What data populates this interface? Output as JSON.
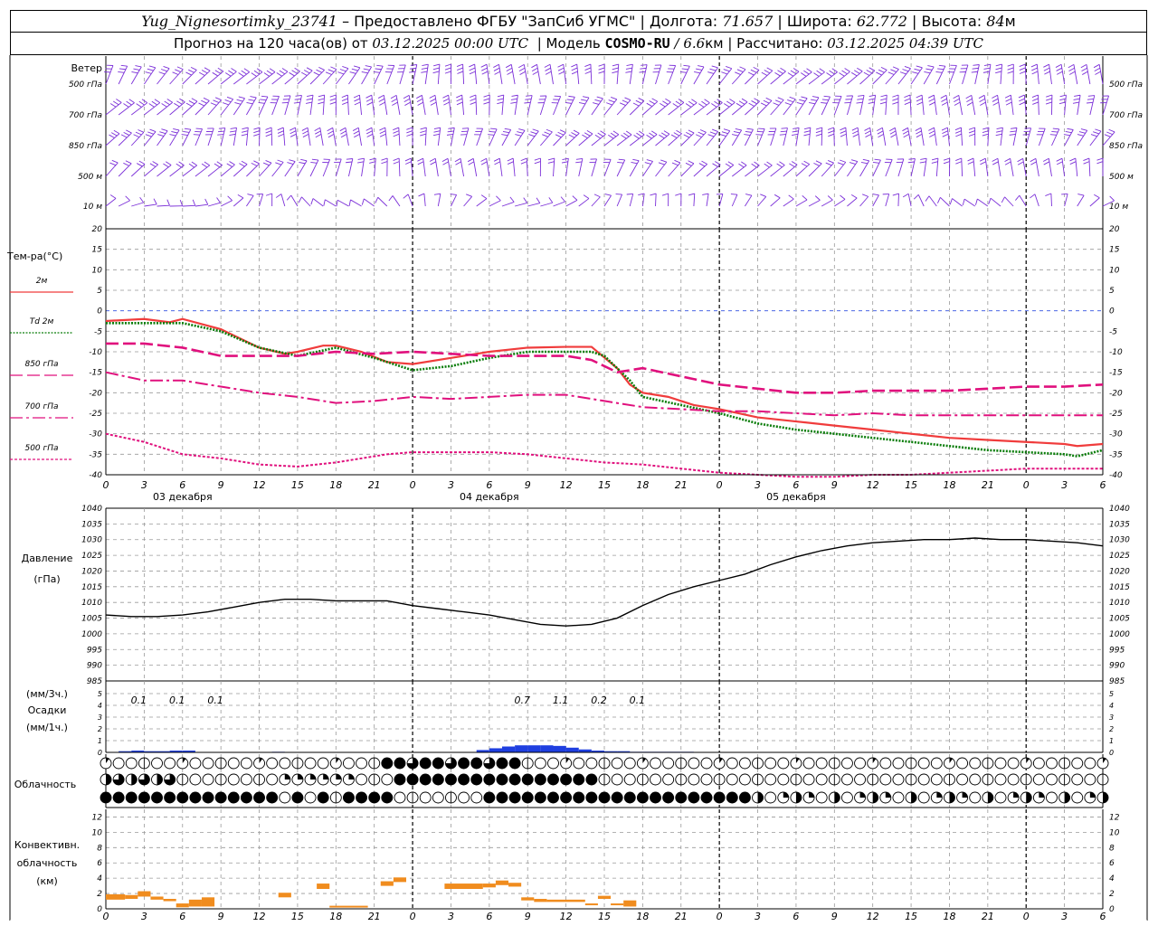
{
  "header": {
    "station": "Yug_Nignesortimky_23741",
    "dash": "–",
    "provided": "Предоставлено ФГБУ \"ЗапСиб УГМС\"",
    "lon_label": "Долгота:",
    "lon": "71.657",
    "lat_label": "Широта:",
    "lat": "62.772",
    "alt_label": "Высота:",
    "alt": "84",
    "alt_unit": "м",
    "forecast_label": "Прогноз на 120 часа(ов) от",
    "forecast_from": "03.12.2025 00:00 UTC",
    "model_label": "Модель",
    "model": "COSMO-RU",
    "resolution": "/ 6.6",
    "res_unit": "км",
    "computed_label": "Рассчитано:",
    "computed": "03.12.2025 04:39 UTC"
  },
  "wind_panel": {
    "title": "Ветер",
    "levels": [
      "500 гПа",
      "700 гПа",
      "850 гПа",
      "500 м",
      "10 м"
    ],
    "color": "#7b2fd8"
  },
  "temp_panel": {
    "title": "Тем-ра(°C)",
    "legend": [
      {
        "label": "2м",
        "color": "#f03c3c",
        "style": "solid"
      },
      {
        "label": "Td 2м",
        "color": "#0a7d0a",
        "style": "dotted"
      },
      {
        "label": "850 гПа",
        "color": "#e0107d",
        "style": "dash"
      },
      {
        "label": "700 гПа",
        "color": "#e0107d",
        "style": "dashdot"
      },
      {
        "label": "500 гПа",
        "color": "#e0107d",
        "style": "dot"
      }
    ],
    "yticks": [
      20,
      15,
      10,
      5,
      0,
      -5,
      -10,
      -15,
      -20,
      -25,
      -30,
      -35,
      -40
    ]
  },
  "time_axis": {
    "hour_labels": [
      "0",
      "3",
      "6",
      "9",
      "12",
      "15",
      "18",
      "21",
      "0",
      "3",
      "6",
      "9",
      "12",
      "15",
      "18",
      "21",
      "0",
      "3",
      "6",
      "9",
      "12",
      "15",
      "18",
      "21",
      "0",
      "3",
      "6"
    ],
    "day_labels": [
      "03 декабря",
      "04 декабря",
      "05 декабря"
    ]
  },
  "pressure_panel": {
    "title": "Давление",
    "unit": "(гПа)",
    "yticks": [
      1040,
      1035,
      1030,
      1025,
      1020,
      1015,
      1010,
      1005,
      1000,
      995,
      990,
      985
    ]
  },
  "precip_panel": {
    "unit3": "(мм/3ч.)",
    "title": "Осадки",
    "unit1": "(мм/1ч.)",
    "yticks": [
      5,
      4,
      3,
      2,
      1,
      0
    ],
    "sums": [
      {
        "t": 3,
        "v": "0.1"
      },
      {
        "t": 6,
        "v": "0.1"
      },
      {
        "t": 9,
        "v": "0.1"
      },
      {
        "t": 33,
        "v": "0.7"
      },
      {
        "t": 36,
        "v": "1.1"
      },
      {
        "t": 39,
        "v": "0.2"
      },
      {
        "t": 42,
        "v": "0.1"
      }
    ],
    "color": "#1f3fe0"
  },
  "cloud_panel": {
    "title": "Облачность"
  },
  "conv_panel": {
    "title_line1": "Конвективн.",
    "title_line2": "облачность",
    "unit": "(км)",
    "yticks": [
      12,
      10,
      8,
      6,
      4,
      2,
      0
    ],
    "color": "#f08c1e"
  },
  "chart_data": [
    {
      "type": "line",
      "title": "Тем-ра(°C)",
      "x_unit": "hours from 03.12.2025 00:00 UTC",
      "ylim": [
        -40,
        20
      ],
      "series": [
        {
          "name": "2м",
          "x": [
            0,
            3,
            5,
            6,
            9,
            12,
            14,
            15,
            17,
            18,
            20,
            22,
            24,
            27,
            30,
            33,
            36,
            38,
            40,
            41,
            42,
            44,
            46,
            48,
            51,
            54,
            57,
            60,
            63,
            66,
            69,
            72,
            75,
            76,
            78
          ],
          "values": [
            -2.5,
            -2,
            -2.8,
            -2,
            -4.5,
            -9,
            -10.5,
            -10,
            -8.5,
            -8.5,
            -10,
            -12.5,
            -13,
            -11.5,
            -10,
            -9,
            -8.8,
            -8.8,
            -14,
            -18,
            -20,
            -21,
            -23,
            -24,
            -26,
            -27,
            -28,
            -29,
            -30,
            -31,
            -31.5,
            -32,
            -32.5,
            -33,
            -32.5
          ]
        },
        {
          "name": "Td 2м",
          "x": [
            0,
            3,
            6,
            9,
            12,
            15,
            18,
            21,
            24,
            27,
            30,
            33,
            36,
            38,
            39,
            40,
            41,
            42,
            45,
            48,
            51,
            54,
            57,
            60,
            63,
            66,
            69,
            72,
            75,
            76,
            78
          ],
          "values": [
            -3,
            -3,
            -3,
            -5,
            -9,
            -11,
            -9,
            -11.5,
            -14.5,
            -13.5,
            -11.5,
            -10,
            -10,
            -10,
            -11,
            -14,
            -17,
            -21,
            -23,
            -25,
            -27.5,
            -29,
            -30,
            -31,
            -32,
            -33,
            -34,
            -34.5,
            -35,
            -35.5,
            -34
          ]
        },
        {
          "name": "850 гПа",
          "x": [
            0,
            3,
            6,
            9,
            12,
            15,
            18,
            21,
            24,
            27,
            30,
            33,
            36,
            38,
            40,
            42,
            45,
            48,
            51,
            54,
            57,
            60,
            63,
            66,
            69,
            72,
            75,
            78
          ],
          "values": [
            -8,
            -8,
            -9,
            -11,
            -11,
            -11,
            -10,
            -10.5,
            -10,
            -10.5,
            -11,
            -11,
            -11,
            -12,
            -15,
            -14,
            -16,
            -18,
            -19,
            -20,
            -20,
            -19.5,
            -19.5,
            -19.5,
            -19,
            -18.5,
            -18.5,
            -18
          ]
        },
        {
          "name": "700 гПа",
          "x": [
            0,
            3,
            6,
            9,
            12,
            15,
            18,
            21,
            24,
            27,
            30,
            33,
            36,
            39,
            42,
            45,
            48,
            51,
            54,
            57,
            60,
            63,
            66,
            69,
            72,
            75,
            78
          ],
          "values": [
            -15,
            -17,
            -17,
            -18.5,
            -20,
            -21,
            -22.5,
            -22,
            -21,
            -21.5,
            -21,
            -20.5,
            -20.5,
            -22,
            -23.5,
            -24,
            -24.5,
            -24.5,
            -25,
            -25.5,
            -25,
            -25.5,
            -25.5,
            -25.5,
            -25.5,
            -25.5,
            -25.5
          ]
        },
        {
          "name": "500 гПа",
          "x": [
            0,
            3,
            6,
            9,
            12,
            15,
            18,
            21,
            22,
            24,
            27,
            30,
            33,
            36,
            39,
            42,
            45,
            48,
            51,
            54,
            57,
            60,
            63,
            66,
            69,
            72,
            75,
            78
          ],
          "values": [
            -30,
            -32,
            -35,
            -36,
            -37.5,
            -38,
            -37,
            -35.5,
            -35,
            -34.5,
            -34.5,
            -34.5,
            -35,
            -36,
            -37,
            -37.5,
            -38.5,
            -39.5,
            -40,
            -40.5,
            -40.5,
            -40,
            -40,
            -39.5,
            -39,
            -38.5,
            -38.5,
            -38.5
          ]
        }
      ]
    },
    {
      "type": "line",
      "title": "Давление",
      "ylabel": "(гПа)",
      "ylim": [
        985,
        1040
      ],
      "series": [
        {
          "x": [
            0,
            2,
            4,
            6,
            8,
            10,
            12,
            14,
            16,
            18,
            20,
            22,
            24,
            26,
            28,
            30,
            32,
            34,
            36,
            38,
            40,
            42,
            44,
            46,
            48,
            50,
            52,
            54,
            56,
            58,
            60,
            62,
            64,
            66,
            68,
            70,
            72,
            74,
            76,
            78
          ],
          "values": [
            1006,
            1005.5,
            1005.5,
            1006,
            1007,
            1008.5,
            1010,
            1011,
            1011,
            1010.5,
            1010.5,
            1010.5,
            1009,
            1008,
            1007,
            1006,
            1004.5,
            1003,
            1002.5,
            1003,
            1005,
            1009,
            1012.5,
            1015,
            1017,
            1019,
            1022,
            1024.5,
            1026.5,
            1028,
            1029,
            1029.5,
            1030,
            1030,
            1030.5,
            1030,
            1030,
            1029.5,
            1029,
            1028
          ]
        }
      ]
    },
    {
      "type": "bar",
      "title": "Осадки",
      "ylabel": "(мм/1ч.)",
      "ylim": [
        0,
        5
      ],
      "x": [
        2,
        3,
        4,
        5,
        6,
        7,
        14,
        30,
        31,
        32,
        33,
        34,
        35,
        36,
        37,
        38,
        39,
        40,
        41,
        42,
        43,
        44,
        45,
        46
      ],
      "values": [
        0.1,
        0.15,
        0.1,
        0.1,
        0.15,
        0.15,
        0.05,
        0.2,
        0.35,
        0.5,
        0.6,
        0.6,
        0.6,
        0.55,
        0.4,
        0.25,
        0.15,
        0.1,
        0.1,
        0.05,
        0.05,
        0.05,
        0.05,
        0.05
      ]
    },
    {
      "type": "bar",
      "title": "Конвективн. облачность",
      "ylabel": "(км)",
      "ylim": [
        0,
        13
      ],
      "bars": [
        {
          "x0": 0,
          "x1": 1.5,
          "bottom": 1.2,
          "top": 1.9
        },
        {
          "x0": 1.5,
          "x1": 2.5,
          "bottom": 1.3,
          "top": 1.8
        },
        {
          "x0": 2.5,
          "x1": 3.5,
          "bottom": 1.6,
          "top": 2.3
        },
        {
          "x0": 3.5,
          "x1": 4.5,
          "bottom": 1.2,
          "top": 1.6
        },
        {
          "x0": 4.5,
          "x1": 5.5,
          "bottom": 1.0,
          "top": 1.3
        },
        {
          "x0": 5.5,
          "x1": 6.5,
          "bottom": 0.2,
          "top": 0.7
        },
        {
          "x0": 6.5,
          "x1": 7.5,
          "bottom": 0.3,
          "top": 1.2
        },
        {
          "x0": 7.5,
          "x1": 8.5,
          "bottom": 0.3,
          "top": 1.5
        },
        {
          "x0": 13.5,
          "x1": 14.5,
          "bottom": 1.5,
          "top": 2.1
        },
        {
          "x0": 16.5,
          "x1": 17.5,
          "bottom": 2.6,
          "top": 3.3
        },
        {
          "x0": 17.5,
          "x1": 20.5,
          "bottom": 0.2,
          "top": 0.4
        },
        {
          "x0": 21.5,
          "x1": 22.5,
          "bottom": 3.0,
          "top": 3.6
        },
        {
          "x0": 22.5,
          "x1": 23.5,
          "bottom": 3.5,
          "top": 4.1
        },
        {
          "x0": 26.5,
          "x1": 29.5,
          "bottom": 2.6,
          "top": 3.3
        },
        {
          "x0": 29.5,
          "x1": 30.5,
          "bottom": 2.8,
          "top": 3.3
        },
        {
          "x0": 30.5,
          "x1": 31.5,
          "bottom": 3.1,
          "top": 3.7
        },
        {
          "x0": 31.5,
          "x1": 32.5,
          "bottom": 2.9,
          "top": 3.4
        },
        {
          "x0": 32.5,
          "x1": 33.5,
          "bottom": 1.1,
          "top": 1.5
        },
        {
          "x0": 33.5,
          "x1": 34.5,
          "bottom": 0.9,
          "top": 1.3
        },
        {
          "x0": 34.5,
          "x1": 37.5,
          "bottom": 0.9,
          "top": 1.2
        },
        {
          "x0": 37.5,
          "x1": 38.5,
          "bottom": 0.5,
          "top": 0.7
        },
        {
          "x0": 38.5,
          "x1": 39.5,
          "bottom": 1.3,
          "top": 1.7
        },
        {
          "x0": 39.5,
          "x1": 40.5,
          "bottom": 0.5,
          "top": 0.7
        },
        {
          "x0": 40.5,
          "x1": 41.5,
          "bottom": 0.3,
          "top": 1.1
        }
      ]
    }
  ]
}
